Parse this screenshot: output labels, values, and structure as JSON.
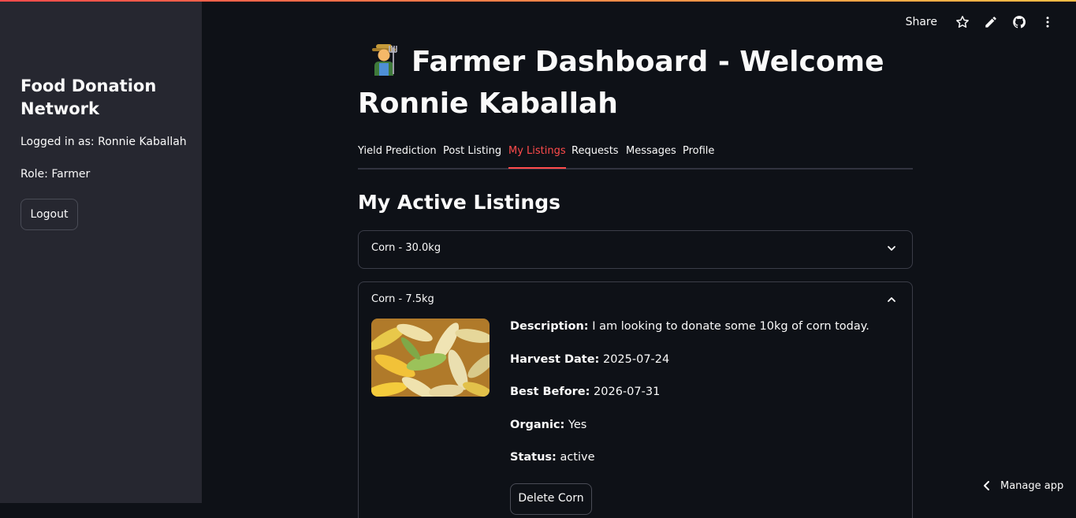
{
  "sidebar": {
    "title": "Food Donation Network",
    "logged_in": "Logged in as: Ronnie Kaballah",
    "role": "Role: Farmer",
    "logout_label": "Logout"
  },
  "toolbar": {
    "share_label": "Share",
    "icons": [
      "star-icon",
      "edit-icon",
      "github-icon",
      "more-vertical-icon"
    ]
  },
  "header": {
    "title": "Farmer Dashboard - Welcome Ronnie Kaballah",
    "emoji": "farmer-emoji"
  },
  "tabs": [
    {
      "label": "Yield Prediction",
      "active": false
    },
    {
      "label": "Post Listing",
      "active": false
    },
    {
      "label": "My Listings",
      "active": true
    },
    {
      "label": "Requests",
      "active": false
    },
    {
      "label": "Messages",
      "active": false
    },
    {
      "label": "Profile",
      "active": false
    }
  ],
  "section_title": "My Active Listings",
  "listings": [
    {
      "header": "Corn - 30.0kg",
      "expanded": false
    },
    {
      "header": "Corn - 7.5kg",
      "expanded": true,
      "description_label": "Description:",
      "description": "I am looking to donate some 10kg of corn today.",
      "harvest_label": "Harvest Date:",
      "harvest_date": "2025-07-24",
      "best_before_label": "Best Before:",
      "best_before": "2026-07-31",
      "organic_label": "Organic:",
      "organic": "Yes",
      "status_label": "Status:",
      "status": "active",
      "delete_label": "Delete Corn"
    }
  ],
  "footer": {
    "manage_label": "Manage app"
  },
  "colors": {
    "accent": "#ff4b4b",
    "background": "#0e1117",
    "sidebar": "#262730"
  }
}
